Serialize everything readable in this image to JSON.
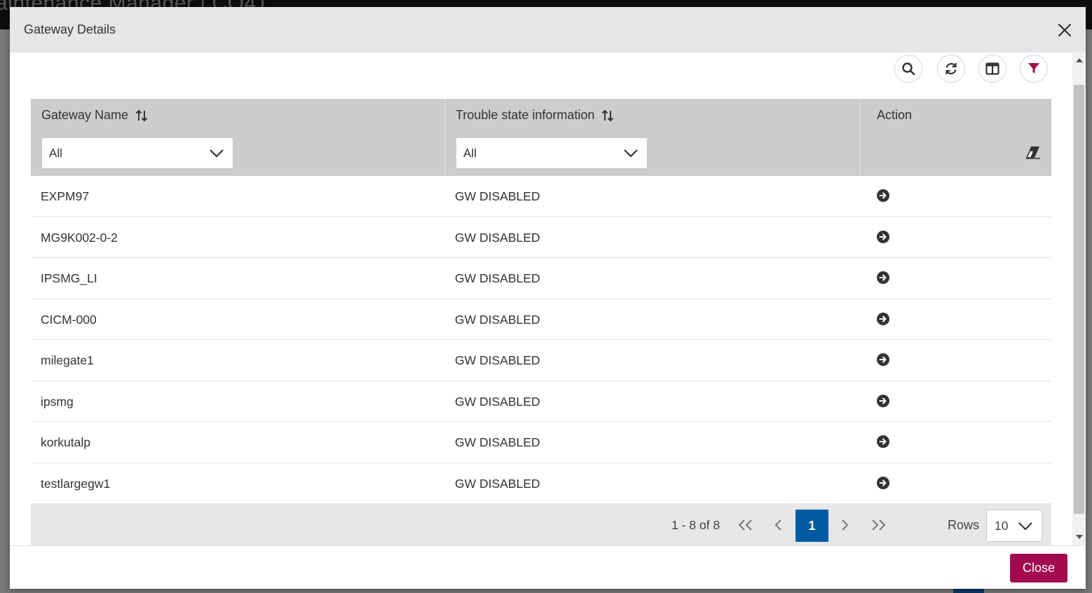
{
  "background": {
    "app_title": "aintenance Manager  |  CO41"
  },
  "dialog": {
    "title": "Gateway Details",
    "close_label": "Close"
  },
  "table": {
    "columns": [
      {
        "label": "Gateway Name",
        "filter_value": "All"
      },
      {
        "label": "Trouble state information",
        "filter_value": "All"
      },
      {
        "label": "Action"
      }
    ],
    "rows": [
      {
        "gateway": "EXPM97",
        "state": "GW DISABLED"
      },
      {
        "gateway": "MG9K002-0-2",
        "state": "GW DISABLED"
      },
      {
        "gateway": "IPSMG_LI",
        "state": "GW DISABLED"
      },
      {
        "gateway": "CICM-000",
        "state": "GW DISABLED"
      },
      {
        "gateway": "milegate1",
        "state": "GW DISABLED"
      },
      {
        "gateway": "ipsmg",
        "state": "GW DISABLED"
      },
      {
        "gateway": "korkutalp",
        "state": "GW DISABLED"
      },
      {
        "gateway": "testlargegw1",
        "state": "GW DISABLED"
      }
    ]
  },
  "paginator": {
    "report": "1 - 8 of 8",
    "current_page": "1",
    "rows_label": "Rows",
    "rows_per_page": "10"
  },
  "toolbar": {
    "icons": [
      "search-icon",
      "refresh-icon",
      "columns-icon",
      "filter-icon"
    ]
  },
  "colors": {
    "primary_button": "#a3094f",
    "active_page": "#005aa0",
    "filter_icon": "#a3094f"
  }
}
